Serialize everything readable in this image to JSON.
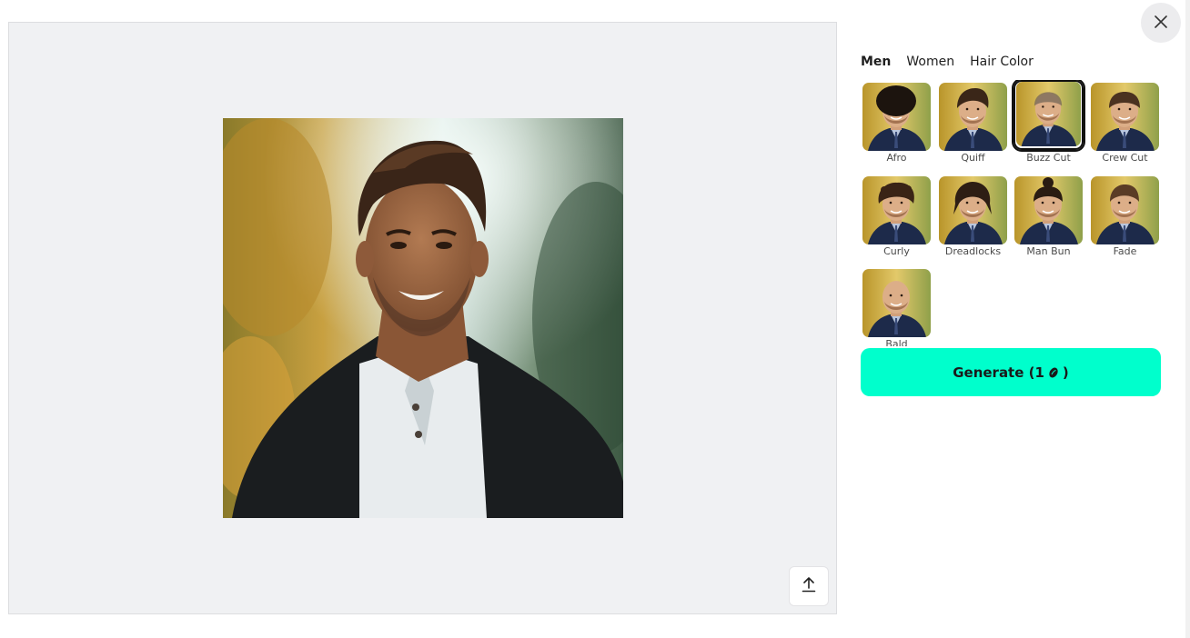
{
  "tabs": [
    {
      "label": "Men",
      "active": true
    },
    {
      "label": "Women",
      "active": false
    },
    {
      "label": "Hair Color",
      "active": false
    }
  ],
  "styles": [
    {
      "label": "Afro",
      "hair": "afro",
      "selected": false
    },
    {
      "label": "Quiff",
      "hair": "quiff",
      "selected": false
    },
    {
      "label": "Buzz Cut",
      "hair": "buzz",
      "selected": true
    },
    {
      "label": "Crew Cut",
      "hair": "crew",
      "selected": false
    },
    {
      "label": "Curly",
      "hair": "curly",
      "selected": false
    },
    {
      "label": "Dreadlocks",
      "hair": "dreads",
      "selected": false
    },
    {
      "label": "Man Bun",
      "hair": "bun",
      "selected": false
    },
    {
      "label": "Fade",
      "hair": "fade",
      "selected": false
    },
    {
      "label": "Bald",
      "hair": "bald",
      "selected": false
    }
  ],
  "generate": {
    "label_prefix": "Generate (1",
    "label_suffix": ")"
  },
  "icons": {
    "close": "close-icon",
    "upload": "upload-icon",
    "coin": "credit-coin-icon"
  },
  "colors": {
    "accent": "#00ffcc",
    "preview_bg": "#f0f1f3"
  }
}
